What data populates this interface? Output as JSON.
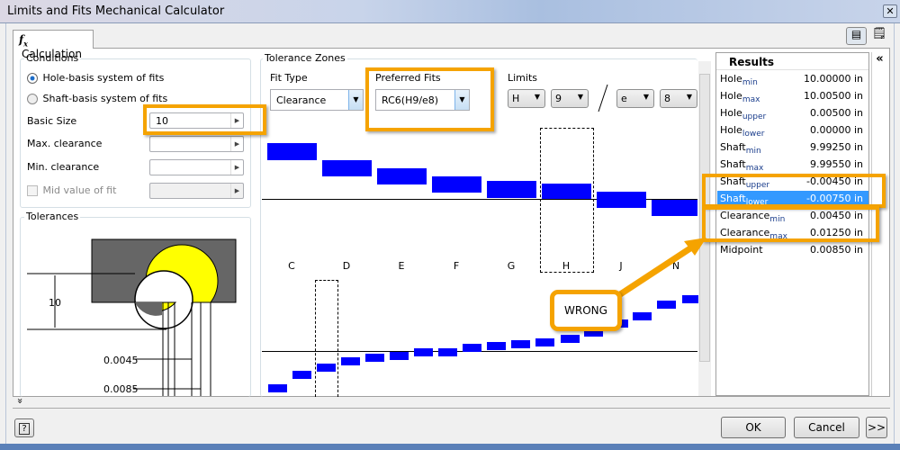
{
  "window": {
    "title": "Limits and Fits Mechanical Calculator",
    "close_icon": "close-icon"
  },
  "tab": {
    "label": "Calculation",
    "icon": "function-icon"
  },
  "toolbar": {
    "icons": [
      "edit-report-icon",
      "notepad-icon"
    ]
  },
  "conditions": {
    "title": "Conditions",
    "hole_basis": "Hole-basis system of fits",
    "shaft_basis": "Shaft-basis system of fits",
    "selected": "hole_basis",
    "basic_size_label": "Basic Size",
    "basic_size_value": "10",
    "max_clearance_label": "Max. clearance",
    "max_clearance_value": "",
    "min_clearance_label": "Min. clearance",
    "min_clearance_value": "",
    "mid_value_label": "Mid value of fit",
    "mid_value_checked": false
  },
  "tolerances": {
    "title": "Tolerances",
    "dim_size": "10",
    "dim_min": "0.0045",
    "dim_max": "0.0085"
  },
  "tolerance_zones": {
    "title": "Tolerance Zones",
    "fit_type_label": "Fit Type",
    "fit_type_value": "Clearance",
    "preferred_fits_label": "Preferred Fits",
    "preferred_fits_value": "RC6(H9/e8)",
    "limits_label": "Limits",
    "limits": {
      "hole_letter": "H",
      "hole_grade": "9",
      "separator": "/",
      "shaft_letter": "e",
      "shaft_grade": "8"
    },
    "hole_zone_letters": [
      "C",
      "D",
      "E",
      "F",
      "G",
      "H",
      "J",
      "N"
    ],
    "selected_hole_zone": "H"
  },
  "results": {
    "title": "Results",
    "rows": [
      {
        "name": "Hole",
        "sub": "min",
        "value": "10.00000 in"
      },
      {
        "name": "Hole",
        "sub": "max",
        "value": "10.00500 in"
      },
      {
        "name": "Hole",
        "sub": "upper",
        "value": "0.00500 in"
      },
      {
        "name": "Hole",
        "sub": "lower",
        "value": "0.00000 in"
      },
      {
        "name": "Shaft",
        "sub": "min",
        "value": "9.99250 in"
      },
      {
        "name": "Shaft",
        "sub": "max",
        "value": "9.99550 in"
      },
      {
        "name": "Shaft",
        "sub": "upper",
        "value": "-0.00450 in"
      },
      {
        "name": "Shaft",
        "sub": "lower",
        "value": "-0.00750 in"
      },
      {
        "name": "Clearance",
        "sub": "min",
        "value": "0.00450 in"
      },
      {
        "name": "Clearance",
        "sub": "max",
        "value": "0.01250 in"
      },
      {
        "name": "Midpoint",
        "sub": "",
        "value": "0.00850 in"
      }
    ],
    "selected_row": 7,
    "collapse_icon": "«"
  },
  "annotation": {
    "callout": "WRONG",
    "color": "#f5a300"
  },
  "footer": {
    "help": "?",
    "ok": "OK",
    "cancel": "Cancel",
    "more": ">>",
    "expand": "»"
  },
  "colors": {
    "zone": "#0000ff",
    "highlight": "#f5a300",
    "selection": "#3399ff"
  }
}
